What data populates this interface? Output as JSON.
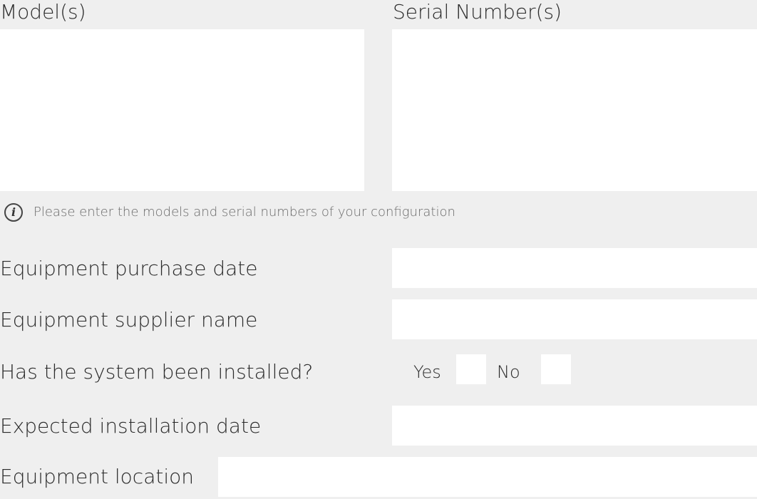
{
  "models": {
    "label": "Model(s)",
    "value": ""
  },
  "serials": {
    "label": "Serial Number(s)",
    "value": ""
  },
  "hint": {
    "icon": "info-icon",
    "text": "Please enter the models and serial numbers of your configuration"
  },
  "purchase_date": {
    "label": "Equipment purchase date",
    "value": ""
  },
  "supplier_name": {
    "label": "Equipment supplier name",
    "value": ""
  },
  "installed": {
    "label": "Has the system been installed?",
    "yes_label": "Yes",
    "no_label": "No"
  },
  "installation_date": {
    "label": "Expected installation date",
    "value": ""
  },
  "location": {
    "label": "Equipment location",
    "value": ""
  }
}
